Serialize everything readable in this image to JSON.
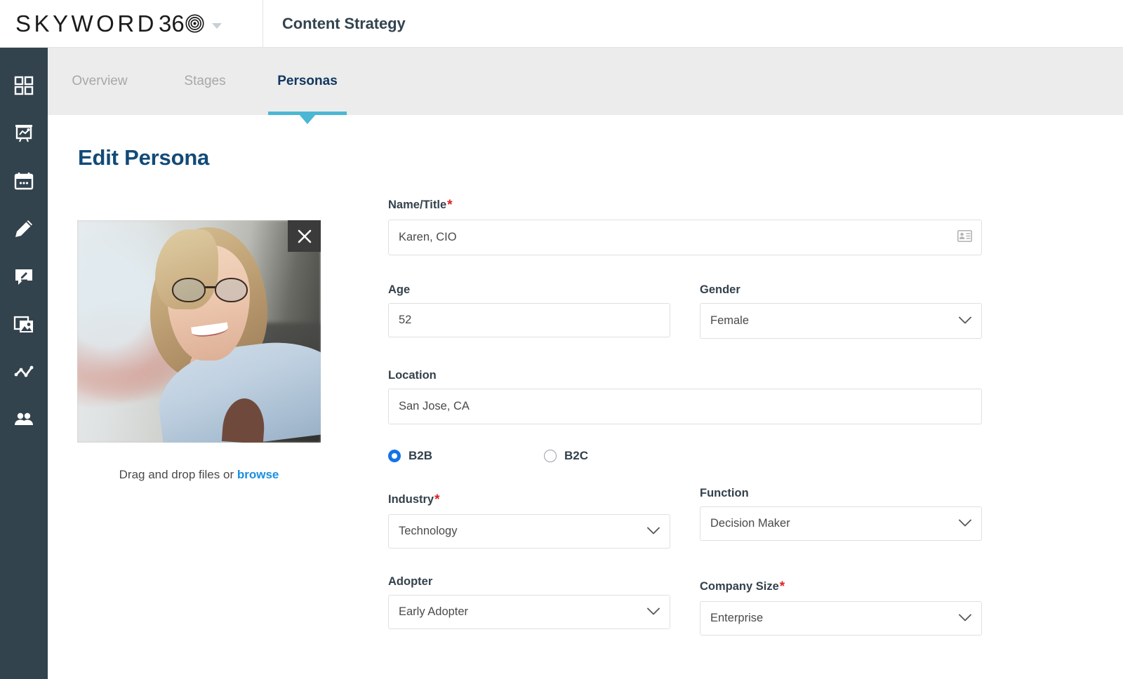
{
  "header": {
    "brand_word": "SKYWORD",
    "brand_number": "36",
    "brand_spiral_icon": "spiral-target-icon",
    "brand_caret_icon": "chevron-down-icon",
    "page_title": "Content Strategy"
  },
  "sidebar": {
    "items": [
      {
        "name": "dashboard",
        "icon": "grid-dashboard-icon"
      },
      {
        "name": "campaigns",
        "icon": "presentation-chart-icon"
      },
      {
        "name": "calendar",
        "icon": "calendar-icon"
      },
      {
        "name": "create",
        "icon": "pencil-icon"
      },
      {
        "name": "review",
        "icon": "comment-edit-icon"
      },
      {
        "name": "assets",
        "icon": "image-gallery-icon"
      },
      {
        "name": "analytics",
        "icon": "line-chart-icon"
      },
      {
        "name": "audience",
        "icon": "people-icon"
      }
    ]
  },
  "tabs": [
    {
      "label": "Overview",
      "active": false
    },
    {
      "label": "Stages",
      "active": false
    },
    {
      "label": "Personas",
      "active": true
    }
  ],
  "main": {
    "heading": "Edit Persona",
    "photo": {
      "close_icon": "close-x-icon",
      "alt": "persona-portrait"
    },
    "upload": {
      "text": "Drag and drop files or",
      "link": "browse"
    },
    "form": {
      "name_title": {
        "label": "Name/Title",
        "required": true,
        "value": "Karen, CIO",
        "icon": "contact-card-icon"
      },
      "age": {
        "label": "Age",
        "required": false,
        "value": "52"
      },
      "gender": {
        "label": "Gender",
        "required": false,
        "value": "Female",
        "icon": "chevron-down-icon"
      },
      "location": {
        "label": "Location",
        "required": false,
        "value": "San Jose, CA"
      },
      "market_type": {
        "options": [
          {
            "label": "B2B",
            "selected": true
          },
          {
            "label": "B2C",
            "selected": false
          }
        ]
      },
      "industry": {
        "label": "Industry",
        "required": true,
        "value": "Technology",
        "icon": "chevron-down-icon"
      },
      "function": {
        "label": "Function",
        "required": false,
        "value": "Decision Maker",
        "icon": "chevron-down-icon"
      },
      "adopter": {
        "label": "Adopter",
        "required": false,
        "value": "Early Adopter",
        "icon": "chevron-down-icon"
      },
      "company_size": {
        "label": "Company Size",
        "required": true,
        "value": "Enterprise",
        "icon": "chevron-down-icon"
      }
    }
  },
  "colors": {
    "sidebar_bg": "#33434d",
    "tab_bar_bg": "#ececec",
    "accent_teal": "#4cb7d4",
    "heading_navy": "#124a77",
    "link_blue": "#1a8fe0",
    "required_red": "#e02020",
    "radio_blue": "#1473e6"
  }
}
